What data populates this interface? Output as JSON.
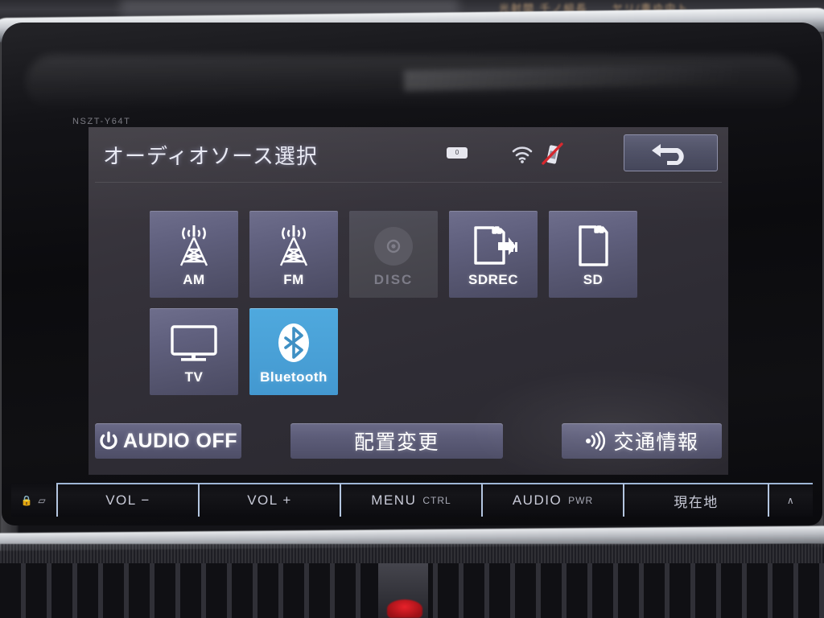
{
  "device": {
    "model_code": "NSZT-Y64T",
    "rearview_blur_text": "光射間 千ノ組長　　ヤリ/車ゆ中ト"
  },
  "screen": {
    "header": {
      "title": "オーディオソース選択",
      "status_icons": [
        {
          "name": "capsule-indicator-icon",
          "glyph": "▯"
        },
        {
          "name": "wifi-icon",
          "glyph": "wifi"
        },
        {
          "name": "phone-disconnected-icon",
          "glyph": "phone-off"
        }
      ],
      "back_button": {
        "label": "戻る",
        "icon": "return-arrow-icon"
      }
    },
    "sources": [
      [
        {
          "id": "am",
          "label": "AM",
          "icon": "radio-tower-icon",
          "state": "normal"
        },
        {
          "id": "fm",
          "label": "FM",
          "icon": "radio-tower-icon",
          "state": "normal"
        },
        {
          "id": "disc",
          "label": "DISC",
          "icon": "disc-icon",
          "state": "disabled"
        },
        {
          "id": "sdrec",
          "label": "SDREC",
          "icon": "sd-record-icon",
          "state": "normal"
        },
        {
          "id": "sd",
          "label": "SD",
          "icon": "sd-card-icon",
          "state": "normal"
        }
      ],
      [
        {
          "id": "tv",
          "label": "TV",
          "icon": "television-icon",
          "state": "normal"
        },
        {
          "id": "bluetooth",
          "label": "Bluetooth",
          "icon": "bluetooth-icon",
          "state": "selected"
        }
      ]
    ],
    "actions": [
      {
        "id": "audio-off",
        "label": "AUDIO OFF",
        "icon": "power-icon"
      },
      {
        "id": "layout",
        "label": "配置変更",
        "icon": null
      },
      {
        "id": "traffic",
        "label": "交通情報",
        "icon": "broadcast-waves-icon"
      }
    ]
  },
  "hardware_buttons": [
    {
      "id": "eject",
      "label": "",
      "sub": "",
      "icon": "lock-eject-icon"
    },
    {
      "id": "vol-down",
      "label": "VOL −",
      "sub": ""
    },
    {
      "id": "vol-up",
      "label": "VOL +",
      "sub": ""
    },
    {
      "id": "menu",
      "label": "MENU",
      "sub": "CTRL"
    },
    {
      "id": "audio",
      "label": "AUDIO",
      "sub": "PWR"
    },
    {
      "id": "genzaichi",
      "label": "現在地",
      "sub": ""
    },
    {
      "id": "misc",
      "label": "",
      "sub": "",
      "icon": "hook-icon"
    }
  ],
  "colors": {
    "tile_normal": "#60607e",
    "tile_disabled": "#49484f",
    "tile_selected": "#4fa9de",
    "screen_bg": "#35323a",
    "text_primary": "#ffffff",
    "text_disabled": "#7d7c88",
    "accent_red": "#e0242c"
  }
}
